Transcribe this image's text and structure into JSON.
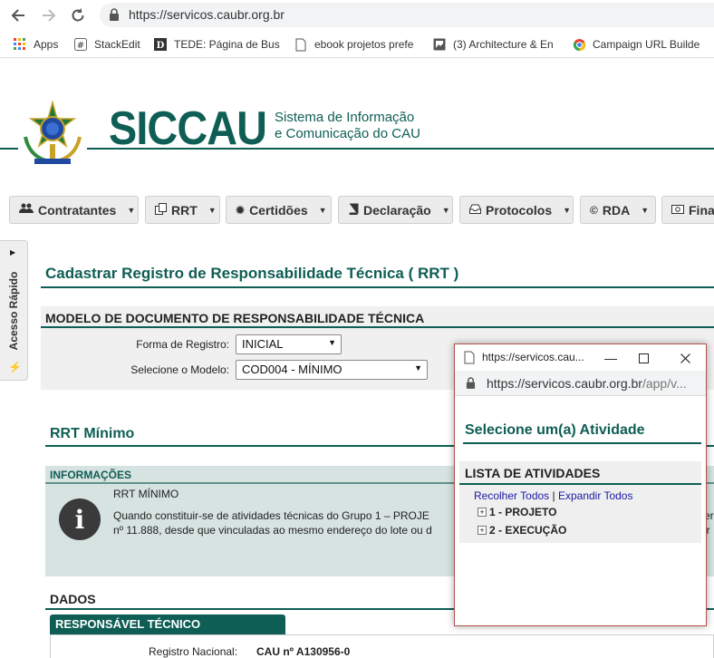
{
  "browser": {
    "url": "https://servicos.caubr.org.br",
    "bookmarks": [
      {
        "label": "Apps",
        "icon": "apps-grid-icon"
      },
      {
        "label": "StackEdit",
        "icon": "stackedit-icon"
      },
      {
        "label": "TEDE: Página de Busc",
        "icon": "tede-icon"
      },
      {
        "label": "ebook projetos prefe",
        "icon": "page-icon"
      },
      {
        "label": "(3) Architecture & En",
        "icon": "bookmark-image-icon"
      },
      {
        "label": "Campaign URL Builde",
        "icon": "chrome-icon"
      }
    ]
  },
  "header": {
    "logo": "SICCAU",
    "subtitle_line1": "Sistema de Informação",
    "subtitle_line2": "e Comunicação do CAU"
  },
  "menu": [
    {
      "label": "Contratantes",
      "icon": "users-icon"
    },
    {
      "label": "RRT",
      "icon": "copy-icon"
    },
    {
      "label": "Certidões",
      "icon": "certificate-icon"
    },
    {
      "label": "Declaração",
      "icon": "book-icon"
    },
    {
      "label": "Protocolos",
      "icon": "inbox-icon"
    },
    {
      "label": "RDA",
      "icon": "copyright-icon"
    },
    {
      "label": "Fina",
      "icon": "money-icon"
    }
  ],
  "side_tab": "Acesso Rápido",
  "main": {
    "title": "Cadastrar Registro de Responsabilidade Técnica ( RRT )",
    "modelo": {
      "heading": "MODELO DE DOCUMENTO DE RESPONSABILIDADE TÉCNICA",
      "forma_label": "Forma de Registro:",
      "forma_value": "INICIAL",
      "modelo_label": "Selecione o Modelo:",
      "modelo_value": "COD004 - MÍNIMO"
    },
    "rrt_title": "RRT Mínimo",
    "info": {
      "heading": "INFORMAÇÕES",
      "line1": "RRT MÍNIMO",
      "line2": "Quando constituir-se de atividades técnicas do Grupo 1 – PROJE",
      "line3": "nº 11.888, desde que vinculadas ao mesmo endereço do lote ou d",
      "trail2": "er",
      "trail3": "ir"
    },
    "dados": {
      "heading": "DADOS",
      "tab": "RESPONSÁVEL TÉCNICO",
      "reg_label": "Registro Nacional:",
      "reg_value": "CAU nº A130956-0"
    }
  },
  "popup": {
    "title": "https://servicos.cau...",
    "url_main": "https://servicos.caubr.org.br",
    "url_rest": "/app/v...",
    "heading": "Selecione um(a) Atividade",
    "list_heading": "LISTA DE ATIVIDADES",
    "collapse_all": "Recolher Todos",
    "separator": "|",
    "expand_all": "Expandir Todos",
    "items": [
      {
        "label": "1 - PROJETO"
      },
      {
        "label": "2 - EXECUÇÃO"
      }
    ]
  },
  "colors": {
    "brand": "#0f5e55",
    "link": "#1a1aa6",
    "popup_border": "#b5534b"
  }
}
